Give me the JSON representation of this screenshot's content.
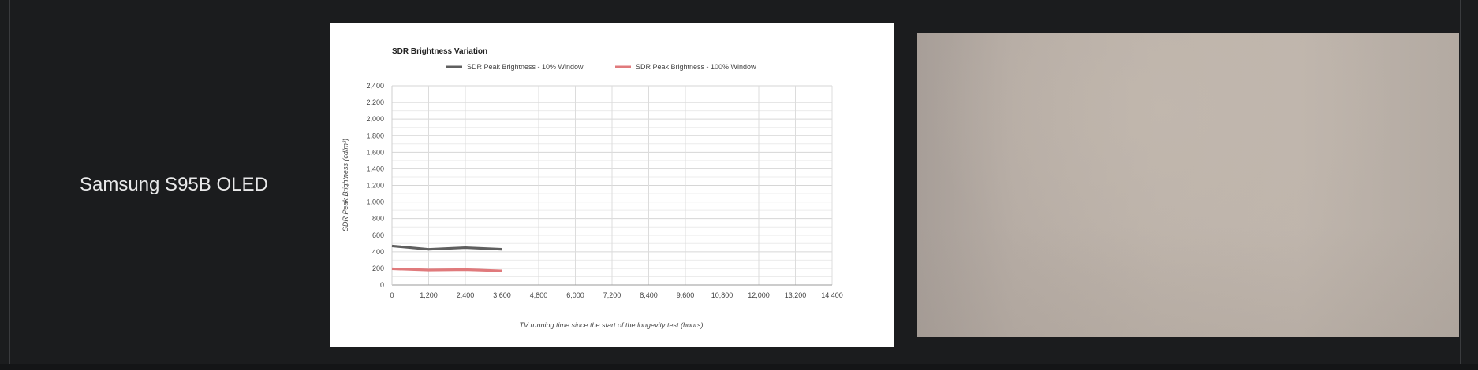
{
  "row": {
    "tv_name": "Samsung S95B OLED"
  },
  "photo": {
    "description_icon": "tv-screen-photo"
  },
  "chart_data": {
    "type": "line",
    "title": "SDR Brightness Variation",
    "xlabel": "TV running time since the start of the longevity test (hours)",
    "ylabel": "SDR Peak Brightness (cd/m²)",
    "xlim": [
      0,
      14400
    ],
    "ylim": [
      0,
      2400
    ],
    "x_ticks": [
      "0",
      "1,200",
      "2,400",
      "3,600",
      "4,800",
      "6,000",
      "7,200",
      "8,400",
      "9,600",
      "10,800",
      "12,000",
      "13,200",
      "14,400"
    ],
    "y_ticks": [
      "0",
      "200",
      "400",
      "600",
      "800",
      "1,000",
      "1,200",
      "1,400",
      "1,600",
      "1,800",
      "2,000",
      "2,200",
      "2,400"
    ],
    "grid": true,
    "legend_position": "top",
    "series": [
      {
        "name": "SDR Peak Brightness - 10% Window",
        "color": "#5f5f5f",
        "x": [
          0,
          1200,
          2400,
          3600
        ],
        "y": [
          470,
          430,
          450,
          430
        ]
      },
      {
        "name": "SDR Peak Brightness - 100% Window",
        "color": "#e07a7c",
        "x": [
          0,
          1200,
          2400,
          3600
        ],
        "y": [
          195,
          180,
          185,
          170
        ]
      }
    ]
  }
}
